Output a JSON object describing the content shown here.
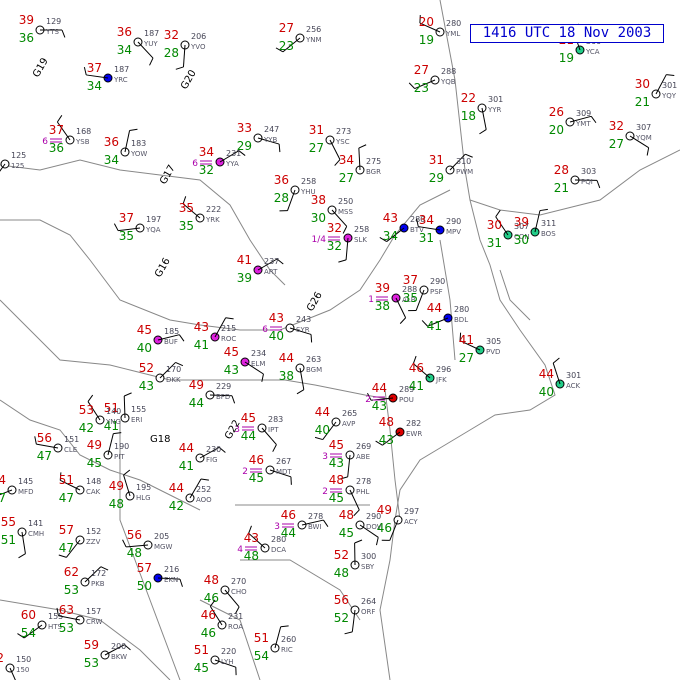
{
  "title": "1416 UTC 18 Nov 2003",
  "colors": {
    "border": "#888888",
    "temp": "#cc0000",
    "dewpoint": "#008800",
    "station_id": "#555566",
    "pressure": "#444455",
    "visibility": "#aa00aa",
    "barb": "#000000",
    "title": "#0000cc"
  },
  "stations": [
    {
      "id": "YTS",
      "t": "39",
      "td": "36",
      "p": "129",
      "sky": "none"
    },
    {
      "id": "YUY",
      "t": "36",
      "td": "34",
      "p": "187",
      "sky": "none"
    },
    {
      "id": "YVO",
      "t": "32",
      "td": "28",
      "p": "206",
      "sky": "none"
    },
    {
      "id": "YNM",
      "t": "27",
      "td": "23",
      "p": "256",
      "sky": "none"
    },
    {
      "id": "YRC",
      "t": "37",
      "td": "34",
      "p": "187",
      "sky": "blue"
    },
    {
      "id": "YSB",
      "t": "37",
      "td": "36",
      "p": "168",
      "vis": "6",
      "sky": "none"
    },
    {
      "id": "YOW",
      "t": "36",
      "td": "34",
      "p": "183",
      "sky": "none"
    },
    {
      "id": "YYA",
      "t": "34",
      "td": "32",
      "p": "231",
      "vis": "6",
      "sky": "magenta"
    },
    {
      "id": "YYB",
      "t": "33",
      "td": "29",
      "p": "247",
      "sky": "none"
    },
    {
      "id": "YSC",
      "t": "31",
      "td": "27",
      "p": "273",
      "sky": "none"
    },
    {
      "id": "YHU",
      "t": "36",
      "td": "28",
      "p": "258",
      "sky": "none"
    },
    {
      "id": "YQB",
      "t": "27",
      "td": "23",
      "p": "288",
      "sky": "none"
    },
    {
      "id": "YML",
      "t": "20",
      "td": "19",
      "p": "280",
      "sky": "none"
    },
    {
      "id": "YCA",
      "t": "21",
      "td": "19",
      "p": "300",
      "sky": "green"
    },
    {
      "id": "YQY",
      "t": "30",
      "td": "21",
      "p": "301",
      "sky": "none"
    },
    {
      "id": "YMT",
      "t": "26",
      "td": "20",
      "p": "309",
      "sky": "none"
    },
    {
      "id": "YQM",
      "t": "32",
      "td": "27",
      "p": "307",
      "sky": "none"
    },
    {
      "id": "YYR",
      "t": "22",
      "td": "18",
      "p": "301",
      "sky": "none"
    },
    {
      "id": "125",
      "t": "",
      "td": "",
      "p": "125",
      "sky": "none"
    },
    {
      "id": "YQA",
      "t": "37",
      "td": "35",
      "p": "197",
      "sky": "none"
    },
    {
      "id": "YRK",
      "t": "35",
      "td": "35",
      "p": "222",
      "sky": "none"
    },
    {
      "id": "BGR",
      "t": "34",
      "td": "27",
      "p": "275",
      "sky": "none"
    },
    {
      "id": "PWM",
      "t": "31",
      "td": "29",
      "p": "310",
      "sky": "none"
    },
    {
      "id": "PQI",
      "t": "28",
      "td": "21",
      "p": "303",
      "sky": "none"
    },
    {
      "id": "MSS",
      "t": "38",
      "td": "30",
      "p": "250",
      "sky": "none"
    },
    {
      "id": "SLK",
      "t": "32",
      "td": "32",
      "p": "258",
      "vis": "1/4",
      "sky": "magenta"
    },
    {
      "id": "BTV",
      "t": "43",
      "td": "34",
      "p": "280",
      "sky": "blue"
    },
    {
      "id": "MPV",
      "t": "34",
      "td": "31",
      "p": "290",
      "sky": "blue"
    },
    {
      "id": "CON",
      "t": "30",
      "td": "31",
      "p": "307",
      "sky": "green"
    },
    {
      "id": "BOS",
      "t": "39",
      "td": "30",
      "p": "311",
      "sky": "green"
    },
    {
      "id": "ART",
      "t": "41",
      "td": "39",
      "p": "237",
      "sky": "magenta"
    },
    {
      "id": "SYR",
      "t": "43",
      "td": "40",
      "p": "243",
      "vis": "6",
      "sky": "none"
    },
    {
      "id": "ALB",
      "t": "39",
      "td": "38",
      "p": "288",
      "vis": "1",
      "sky": "magenta"
    },
    {
      "id": "PSF",
      "t": "37",
      "td": "35",
      "p": "290",
      "sky": "none"
    },
    {
      "id": "BDL",
      "t": "44",
      "td": "41",
      "p": "280",
      "sky": "blue"
    },
    {
      "id": "PVD",
      "t": "41",
      "td": "27",
      "p": "305",
      "sky": "green"
    },
    {
      "id": "ACK",
      "t": "44",
      "td": "40",
      "p": "301",
      "sky": "green"
    },
    {
      "id": "ROC",
      "t": "43",
      "td": "41",
      "p": "215",
      "sky": "magenta"
    },
    {
      "id": "BUF",
      "t": "45",
      "td": "40",
      "p": "185",
      "sky": "magenta"
    },
    {
      "id": "ELM",
      "t": "45",
      "td": "43",
      "p": "234",
      "sky": "magenta"
    },
    {
      "id": "BGM",
      "t": "44",
      "td": "38",
      "p": "263",
      "sky": "none"
    },
    {
      "id": "AVP",
      "t": "44",
      "td": "40",
      "p": "265",
      "sky": "none"
    },
    {
      "id": "POU",
      "t": "44",
      "td": "43",
      "p": "289",
      "vis": "2",
      "sky": "red"
    },
    {
      "id": "JFK",
      "t": "46",
      "td": "41",
      "p": "296",
      "sky": "green"
    },
    {
      "id": "ERI",
      "t": "51",
      "td": "41",
      "p": "155",
      "sky": "none"
    },
    {
      "id": "DKK",
      "t": "52",
      "td": "43",
      "p": "170",
      "sky": "none"
    },
    {
      "id": "BFD",
      "t": "49",
      "td": "44",
      "p": "229",
      "sky": "none"
    },
    {
      "id": "IPT",
      "t": "45",
      "td": "44",
      "p": "283",
      "vis": "3",
      "sky": "none"
    },
    {
      "id": "ABE",
      "t": "45",
      "td": "43",
      "p": "269",
      "vis": "3",
      "sky": "none"
    },
    {
      "id": "EWR",
      "t": "48",
      "td": "43",
      "p": "282",
      "sky": "red"
    },
    {
      "id": "CLE",
      "t": "56",
      "td": "47",
      "p": "151",
      "sky": "none"
    },
    {
      "id": "YNG",
      "t": "53",
      "td": "42",
      "p": "140",
      "sky": "none"
    },
    {
      "id": "PIT",
      "t": "49",
      "td": "45",
      "p": "190",
      "sky": "none"
    },
    {
      "id": "FIG",
      "t": "44",
      "td": "41",
      "p": "230",
      "sky": "none"
    },
    {
      "id": "MDT",
      "t": "46",
      "td": "45",
      "p": "267",
      "vis": "2",
      "sky": "none"
    },
    {
      "id": "PHL",
      "t": "48",
      "td": "45",
      "p": "278",
      "vis": "2",
      "sky": "none"
    },
    {
      "id": "ACY",
      "t": "49",
      "td": "46",
      "p": "297",
      "sky": "none"
    },
    {
      "id": "MFD",
      "t": "54",
      "td": "47",
      "p": "145",
      "sky": "none"
    },
    {
      "id": "CAK",
      "t": "51",
      "td": "47",
      "p": "148",
      "sky": "none"
    },
    {
      "id": "HLG",
      "t": "49",
      "td": "48",
      "p": "195",
      "sky": "none"
    },
    {
      "id": "AOO",
      "t": "44",
      "td": "42",
      "p": "252",
      "sky": "none"
    },
    {
      "id": "BWI",
      "t": "46",
      "td": "44",
      "p": "278",
      "vis": "3",
      "sky": "none"
    },
    {
      "id": "DOV",
      "t": "48",
      "td": "45",
      "p": "290",
      "sky": "none"
    },
    {
      "id": "CMH",
      "t": "55",
      "td": "51",
      "p": "141",
      "sky": "none"
    },
    {
      "id": "ZZV",
      "t": "57",
      "td": "47",
      "p": "152",
      "sky": "none"
    },
    {
      "id": "MGW",
      "t": "56",
      "td": "48",
      "p": "205",
      "sky": "none"
    },
    {
      "id": "DCA",
      "t": "43",
      "td": "48",
      "p": "280",
      "vis": "4",
      "sky": "none"
    },
    {
      "id": "SBY",
      "t": "52",
      "td": "48",
      "p": "300",
      "sky": "none"
    },
    {
      "id": "PKB",
      "t": "62",
      "td": "53",
      "p": "172",
      "sky": "none"
    },
    {
      "id": "EKN",
      "t": "57",
      "td": "50",
      "p": "216",
      "sky": "blue"
    },
    {
      "id": "CHO",
      "t": "48",
      "td": "46",
      "p": "270",
      "sky": "none"
    },
    {
      "id": "ORF",
      "t": "56",
      "td": "52",
      "p": "264",
      "sky": "none"
    },
    {
      "id": "HTS",
      "t": "60",
      "td": "54",
      "p": "155",
      "sky": "none"
    },
    {
      "id": "CRW",
      "t": "63",
      "td": "53",
      "p": "157",
      "sky": "none"
    },
    {
      "id": "ROA",
      "t": "46",
      "td": "46",
      "p": "231",
      "sky": "none"
    },
    {
      "id": "RIC",
      "t": "51",
      "td": "54",
      "p": "260",
      "sky": "none"
    },
    {
      "id": "BKW",
      "t": "59",
      "td": "53",
      "p": "200",
      "sky": "none"
    },
    {
      "id": "LYH",
      "t": "51",
      "td": "45",
      "p": "220",
      "sky": "none"
    },
    {
      "id": "150",
      "t": "62",
      "td": "",
      "p": "150",
      "sky": "none"
    }
  ],
  "visible_text_fragments": [
    "G19",
    "G20",
    "G17",
    "G16",
    "G18",
    "G26",
    "G22",
    "B",
    "C",
    "1416 UTC 18 Nov 2003"
  ]
}
